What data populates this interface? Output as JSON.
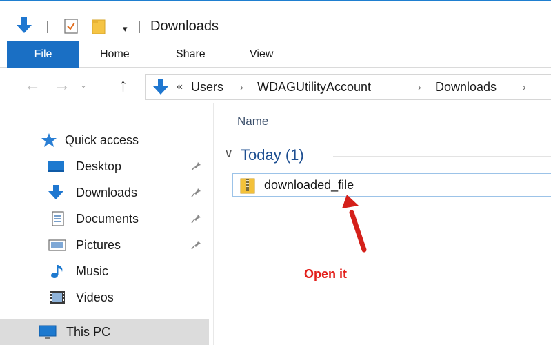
{
  "window": {
    "title": "Downloads"
  },
  "quick_access_toolbar": {
    "dropdown_glyph": "▾",
    "icons": [
      "down-arrow-icon",
      "properties-icon",
      "new-folder-icon",
      "customize-dropdown-icon"
    ]
  },
  "ribbon": {
    "tabs": [
      "File",
      "Home",
      "Share",
      "View"
    ],
    "active_tab_color": "#1a6fc4"
  },
  "navigation": {
    "back_glyph": "←",
    "forward_glyph": "→",
    "recent_glyph": "⌄",
    "up_glyph": "↑",
    "overflow_glyph": "«",
    "separator_glyph": "›",
    "breadcrumb": [
      "Users",
      "WDAGUtilityAccount",
      "Downloads"
    ]
  },
  "sidebar": {
    "quick_access": {
      "label": "Quick access",
      "icon": "star-icon"
    },
    "items": [
      {
        "label": "Desktop",
        "icon": "desktop-icon",
        "pinned": true
      },
      {
        "label": "Downloads",
        "icon": "downloads-icon",
        "pinned": true
      },
      {
        "label": "Documents",
        "icon": "documents-icon",
        "pinned": true
      },
      {
        "label": "Pictures",
        "icon": "pictures-icon",
        "pinned": true
      },
      {
        "label": "Music",
        "icon": "music-icon",
        "pinned": false
      },
      {
        "label": "Videos",
        "icon": "videos-icon",
        "pinned": false
      }
    ],
    "this_pc": {
      "label": "This PC",
      "icon": "computer-icon",
      "selected": true
    }
  },
  "content": {
    "column_header": "Name",
    "group": {
      "chevron": "∨",
      "title": "Today (1)"
    },
    "files": [
      {
        "name": "downloaded_file",
        "icon": "zip-folder-icon"
      }
    ]
  },
  "annotation": {
    "text": "Open it",
    "color": "#e3201b"
  },
  "colors": {
    "accent": "#1a6fc4",
    "folder_blue": "#1e4f91",
    "selection_border": "#9cc3e8"
  }
}
